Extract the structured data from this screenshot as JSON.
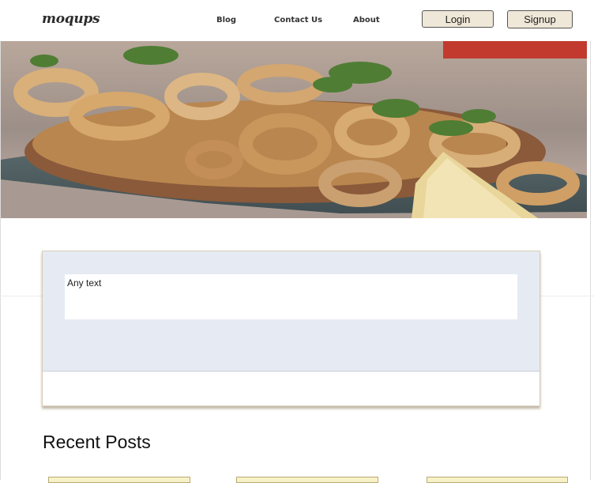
{
  "header": {
    "logo_text": "moqups",
    "nav": {
      "blog": "Blog",
      "contact": "Contact Us",
      "about": "About"
    },
    "login_label": "Login",
    "signup_label": "Signup"
  },
  "hero": {
    "image_name": "fried-calamari-platter-image"
  },
  "card": {
    "input_text": "Any text"
  },
  "recent": {
    "title": "Recent Posts"
  },
  "colors": {
    "button_bg": "#efe7d7",
    "card_top_bg": "#e6ebf3",
    "post_card_bg": "#f7f1c8"
  }
}
